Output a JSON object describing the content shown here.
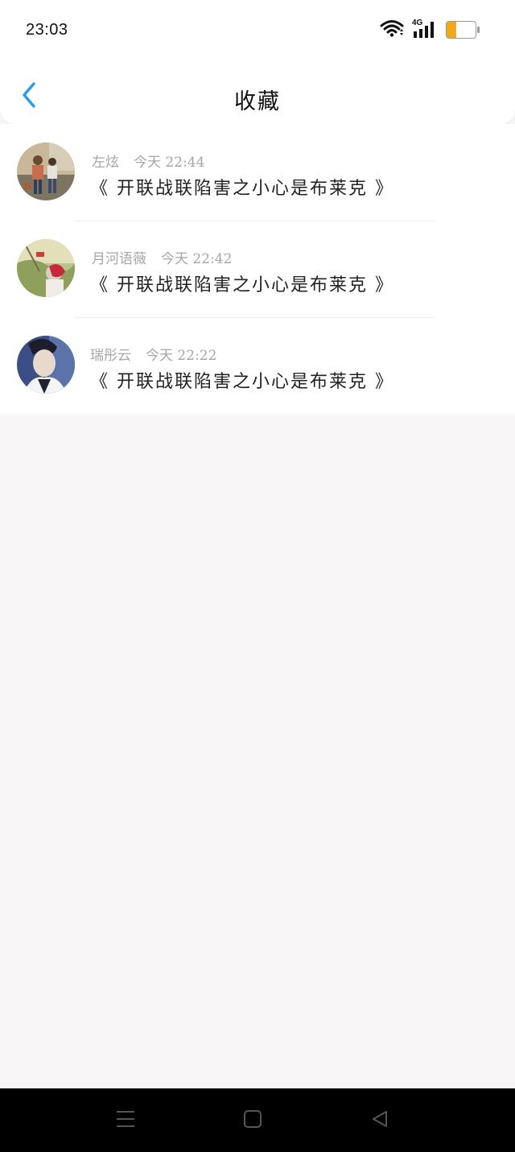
{
  "status_bar": {
    "time": "23:03",
    "network": "4G",
    "battery_level": "32",
    "battery_fraction": 0.32,
    "icons": [
      "wifi-icon",
      "signal-icon",
      "battery-icon"
    ]
  },
  "header": {
    "title": "收藏",
    "back_icon": "chevron-left-icon",
    "accent_color": "#2a9af0"
  },
  "favorites": [
    {
      "user": "左炫",
      "time": "今天 22:44",
      "title": "《 开联战联陷害之小心是布莱克 》"
    },
    {
      "user": "月河语薇",
      "time": "今天 22:42",
      "title": "《 开联战联陷害之小心是布莱克 》"
    },
    {
      "user": "瑞彤云",
      "time": "今天 22:22",
      "title": "《 开联战联陷害之小心是布莱克 》"
    }
  ],
  "nav_bar": {
    "icons": [
      "menu-icon",
      "home-icon",
      "back-triangle-icon"
    ]
  }
}
